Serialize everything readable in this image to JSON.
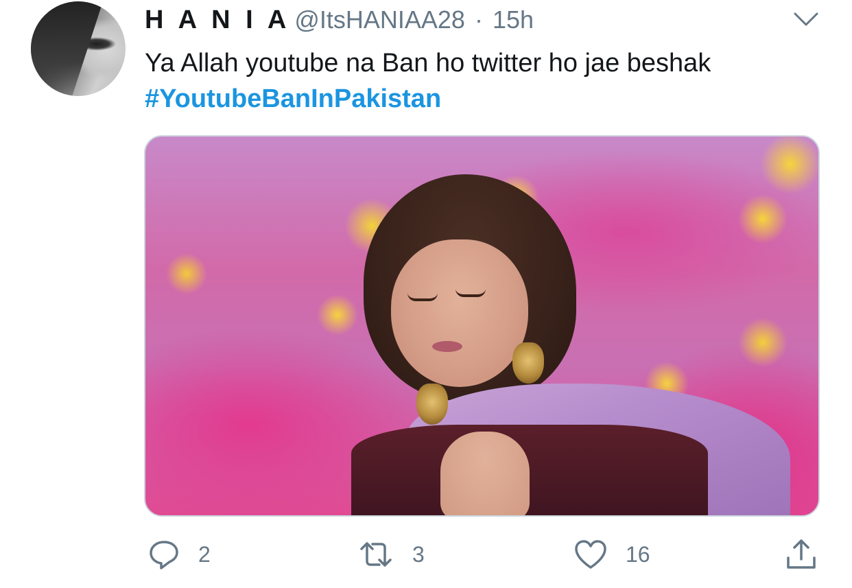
{
  "tweet": {
    "author": {
      "display_name": "H A N I A",
      "handle": "@ItsHANIAA28",
      "separator": "·",
      "time": "15h"
    },
    "text": "Ya Allah youtube na Ban ho twitter ho jae beshak",
    "hashtag": "#YoutubeBanInPakistan",
    "actions": {
      "reply_count": "2",
      "retweet_count": "3",
      "like_count": "16"
    }
  },
  "colors": {
    "text": "#14171a",
    "secondary": "#657786",
    "link": "#1b95e0",
    "border": "#ccd6dd"
  },
  "icons": {
    "menu": "chevron-down-icon",
    "reply": "reply-icon",
    "retweet": "retweet-icon",
    "like": "heart-icon",
    "share": "share-icon"
  }
}
